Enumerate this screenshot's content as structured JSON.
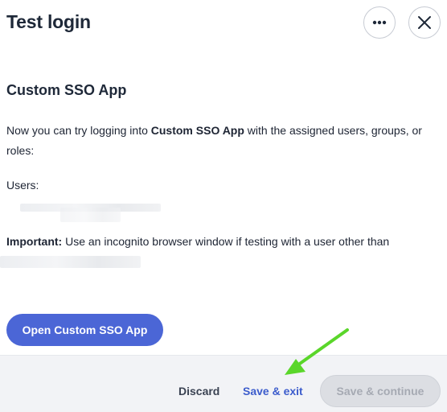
{
  "dialog": {
    "title": "Test login"
  },
  "header": {
    "more_icon": "more-horizontal-icon",
    "close_icon": "close-icon"
  },
  "content": {
    "app_name": "Custom SSO App",
    "intro_prefix": "Now you can try logging into ",
    "intro_app": "Custom SSO App",
    "intro_suffix": " with the assigned users, groups, or roles:",
    "users_label": "Users:",
    "important_label": "Important:",
    "important_text": " Use an incognito browser window if testing with a user other than"
  },
  "actions": {
    "open_app_label": "Open Custom SSO App",
    "discard_label": "Discard",
    "save_exit_label": "Save & exit",
    "save_continue_label": "Save & continue"
  },
  "colors": {
    "primary": "#4b66d6",
    "link": "#3c5ccc",
    "annotation_arrow": "#5ad62a"
  }
}
